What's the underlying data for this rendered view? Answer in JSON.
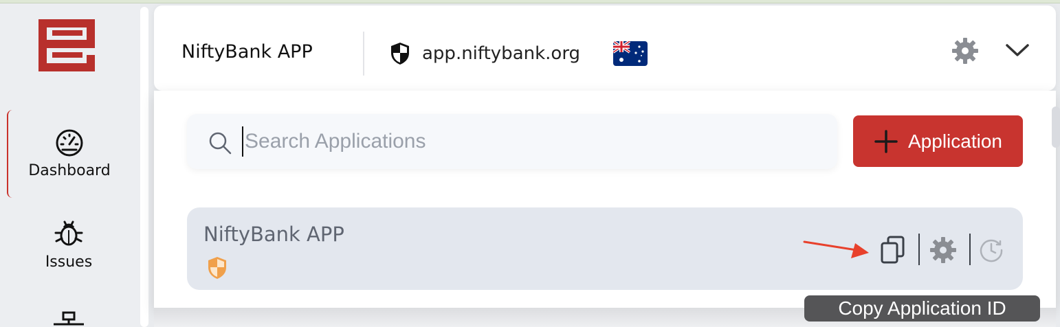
{
  "sidebar": {
    "items": [
      {
        "label": "Dashboard",
        "icon": "speedometer-icon",
        "active": true
      },
      {
        "label": "Issues",
        "icon": "bug-icon",
        "active": false
      },
      {
        "label": "",
        "icon": "network-icon",
        "active": false
      }
    ]
  },
  "header": {
    "app_name": "NiftyBank APP",
    "domain": "app.niftybank.org",
    "region_flag": "australia-flag-icon"
  },
  "search": {
    "placeholder": "Search Applications",
    "value": ""
  },
  "add_button": {
    "label": "Application"
  },
  "applications": [
    {
      "name": "NiftyBank APP",
      "status_icon": "orange-shield-icon"
    }
  ],
  "tooltip": {
    "text": "Copy Application ID"
  },
  "colors": {
    "accent": "#c8342f",
    "row_bg": "#e3e7ee",
    "shield_orange": "#f0a04b",
    "annotation_arrow": "#e8412c"
  }
}
